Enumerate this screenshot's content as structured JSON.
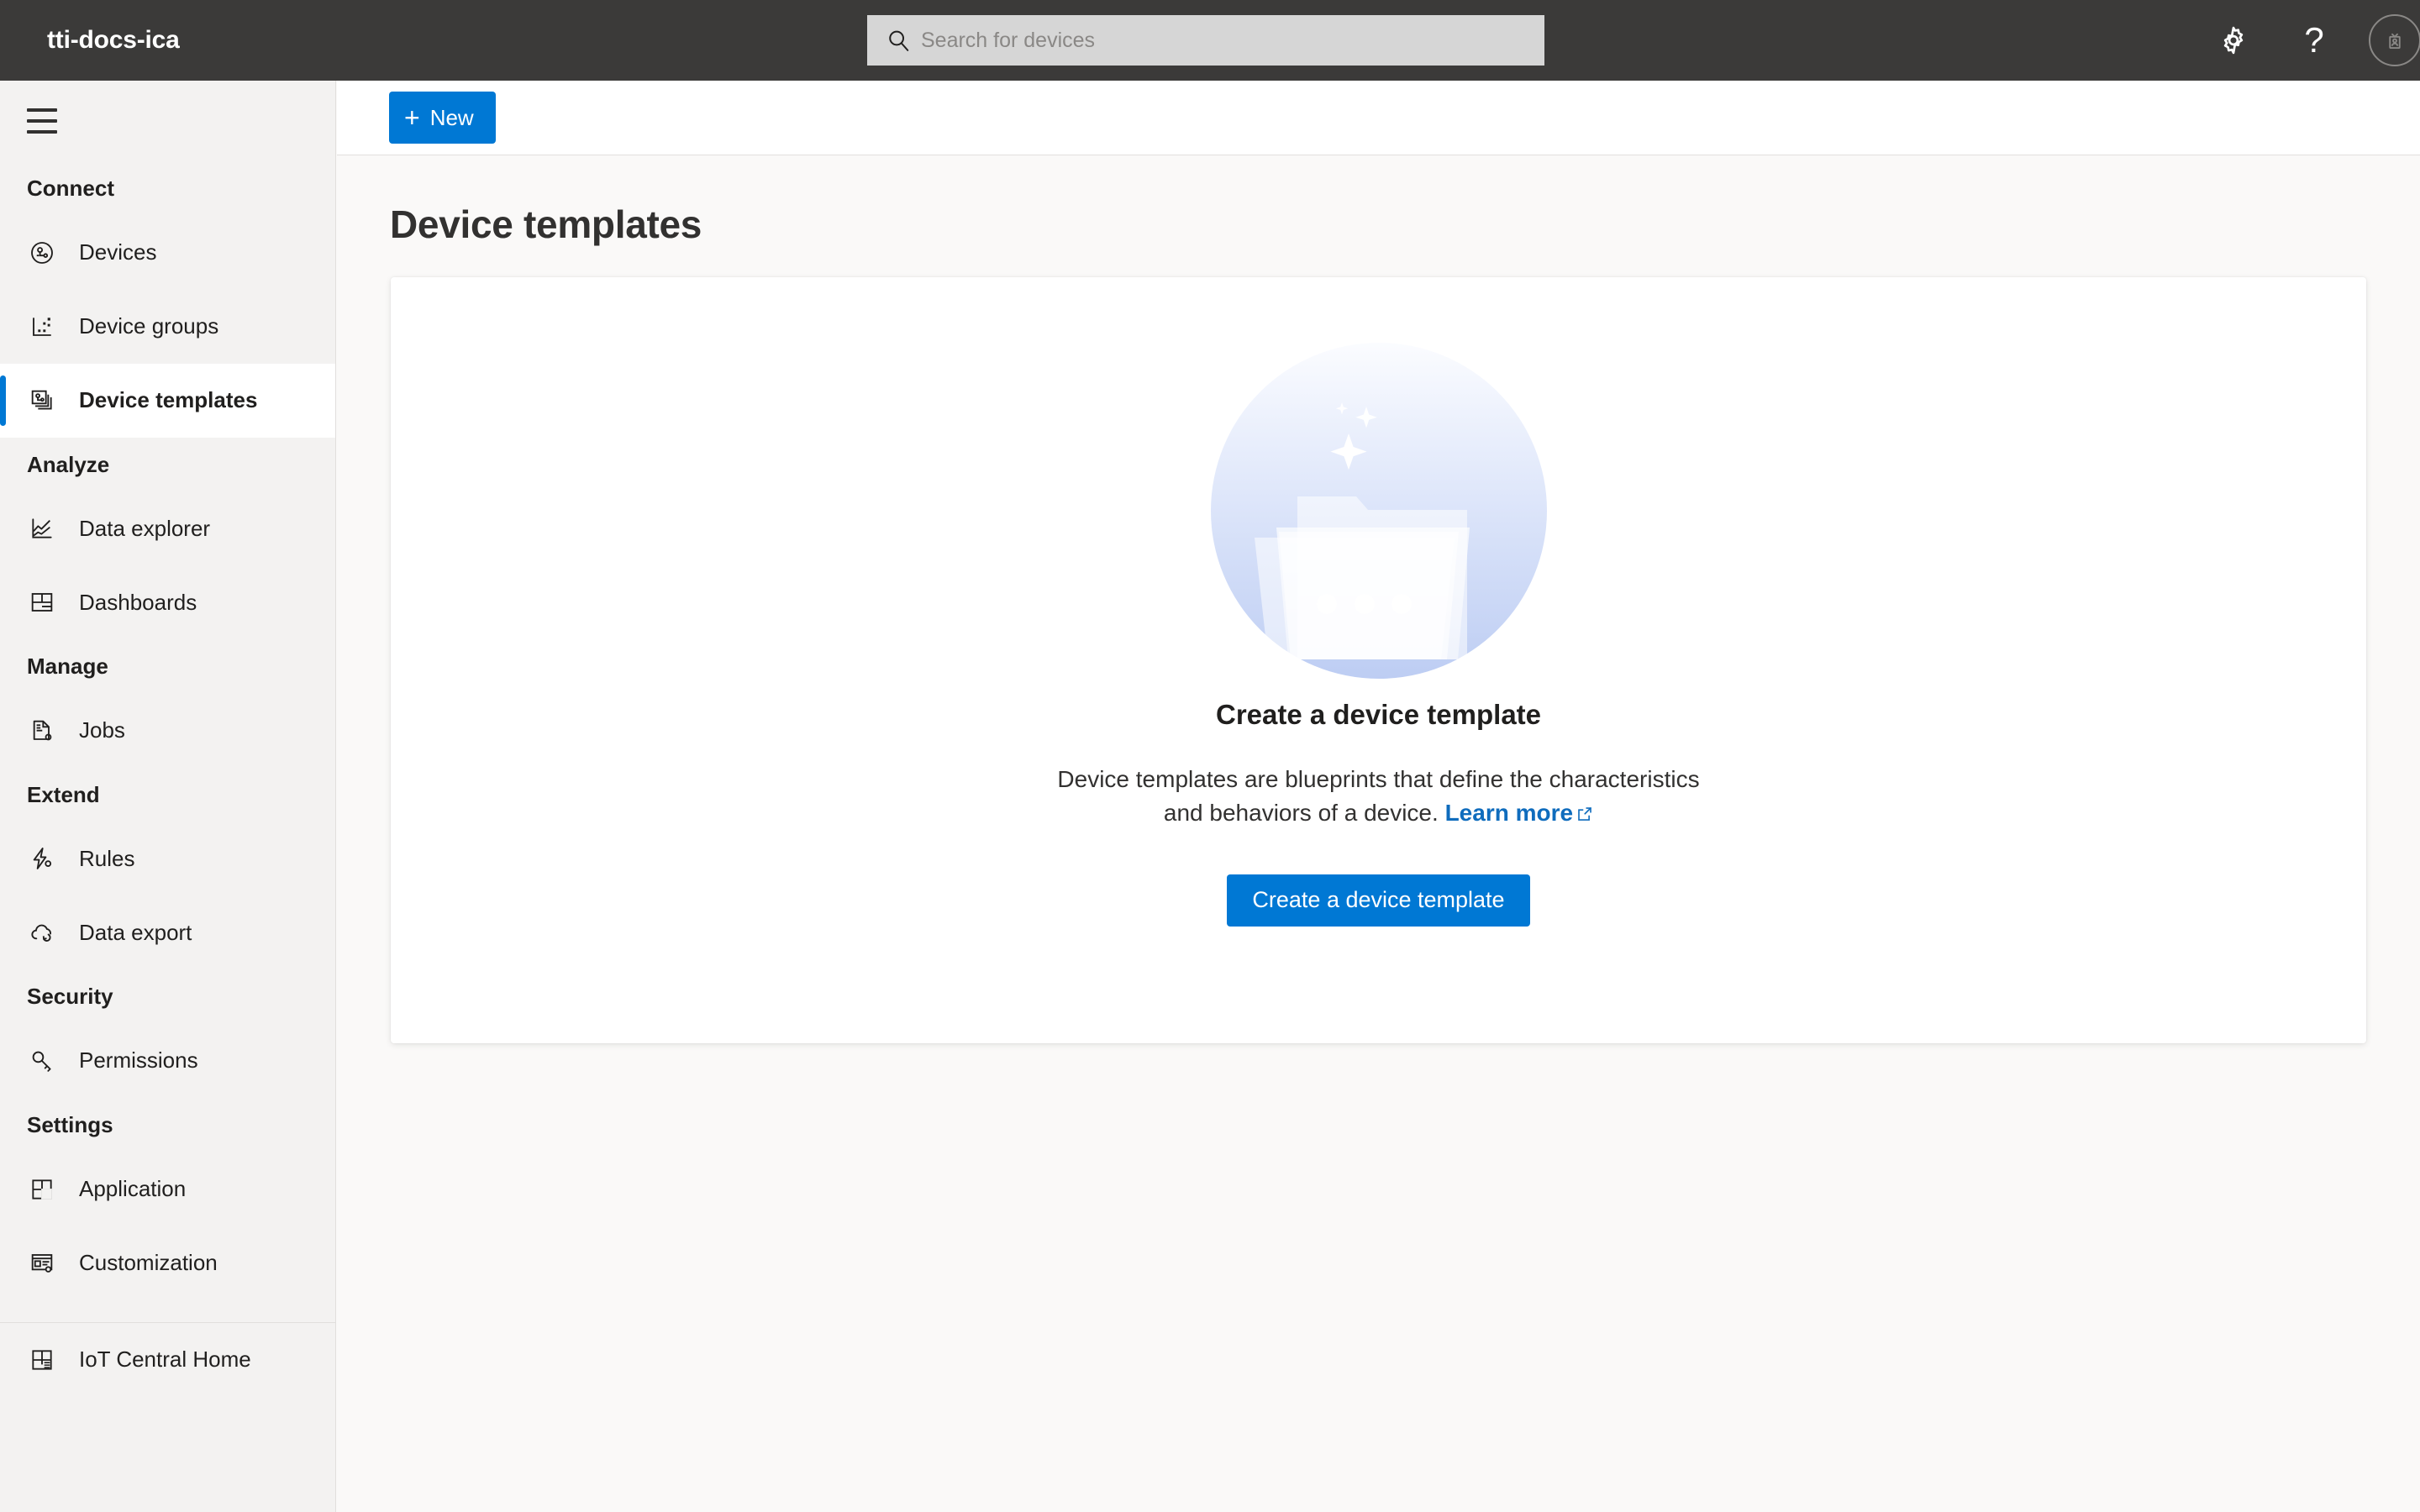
{
  "topbar": {
    "app_title": "tti-docs-ica",
    "background_color": "#3b3a39",
    "search": {
      "placeholder": "Search for devices",
      "value": "",
      "icon": "search-icon"
    },
    "actions": [
      {
        "name": "settings",
        "icon": "gear-icon"
      },
      {
        "name": "help",
        "icon": "question-mark-icon",
        "glyph": "?"
      },
      {
        "name": "account",
        "icon": "id-badge-avatar-icon"
      }
    ]
  },
  "sidebar": {
    "menu_icon": "hamburger-menu-icon",
    "groups": [
      {
        "title": "Connect",
        "items": [
          {
            "label": "Devices",
            "icon": "device-icon",
            "selected": false
          },
          {
            "label": "Device groups",
            "icon": "device-groups-icon",
            "selected": false
          },
          {
            "label": "Device templates",
            "icon": "device-templates-icon",
            "selected": true
          }
        ]
      },
      {
        "title": "Analyze",
        "items": [
          {
            "label": "Data explorer",
            "icon": "line-chart-icon",
            "selected": false
          },
          {
            "label": "Dashboards",
            "icon": "dashboard-grid-icon",
            "selected": false
          }
        ]
      },
      {
        "title": "Manage",
        "items": [
          {
            "label": "Jobs",
            "icon": "document-gear-icon",
            "selected": false
          }
        ]
      },
      {
        "title": "Extend",
        "items": [
          {
            "label": "Rules",
            "icon": "lightning-gear-icon",
            "selected": false
          },
          {
            "label": "Data export",
            "icon": "cloud-sync-icon",
            "selected": false
          }
        ]
      },
      {
        "title": "Security",
        "items": [
          {
            "label": "Permissions",
            "icon": "key-icon",
            "selected": false
          }
        ]
      },
      {
        "title": "Settings",
        "items": [
          {
            "label": "Application",
            "icon": "app-tiles-icon",
            "selected": false
          },
          {
            "label": "Customization",
            "icon": "customization-icon",
            "selected": false
          }
        ]
      }
    ],
    "footer_items": [
      {
        "label": "IoT Central Home",
        "icon": "iot-central-home-icon"
      }
    ],
    "accent_color": "#0078d4",
    "background_color": "#f3f2f1"
  },
  "commandbar": {
    "new_label": "New",
    "new_icon": "plus-icon",
    "new_color": "#0078d4"
  },
  "main": {
    "page_title": "Device templates",
    "empty_state": {
      "illustration": "folder-documents-sparkle-illustration",
      "heading": "Create a device template",
      "description_before_link": "Device templates are blueprints that define the characteristics and behaviors of a device. ",
      "link_label": "Learn more",
      "link_icon": "external-link-icon",
      "cta_label": "Create a device template"
    }
  }
}
